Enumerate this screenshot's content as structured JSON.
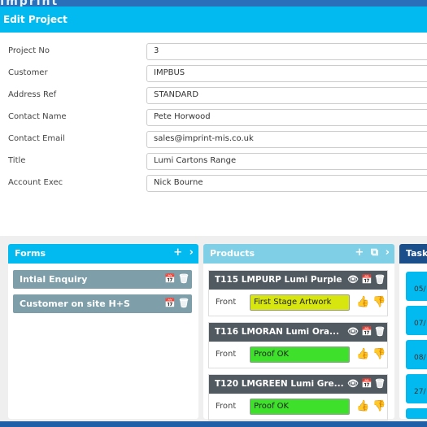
{
  "window": {
    "title": "Edit Project",
    "background_logo": "Imprint"
  },
  "fields": [
    {
      "label": "Project No",
      "value": "3"
    },
    {
      "label": "Customer",
      "value": "IMPBUS"
    },
    {
      "label": "Address Ref",
      "value": "STANDARD"
    },
    {
      "label": "Contact Name",
      "value": "Pete Horwood"
    },
    {
      "label": "Contact Email",
      "value": "sales@imprint-mis.co.uk"
    },
    {
      "label": "Title",
      "value": "Lumi Cartons Range"
    },
    {
      "label": "Account Exec",
      "value": "Nick Bourne"
    }
  ],
  "forms_panel": {
    "title": "Forms",
    "add_icon": "+",
    "chevron_icon": "›",
    "items": [
      {
        "label": "Intial Enquiry"
      },
      {
        "label": "Customer on site H+S"
      }
    ]
  },
  "products_panel": {
    "title": "Products",
    "add_icon": "+",
    "copy_icon": "⧉",
    "chevron_icon": "›",
    "items": [
      {
        "title": "T115 LMPURP Lumi Purple",
        "side": "Front",
        "status": "First Stage Artwork",
        "status_color": "#d6e60e",
        "down_color": "#555555"
      },
      {
        "title": "T116 LMORAN Lumi Ora...",
        "side": "Front",
        "status": "Proof OK",
        "status_color": "#3ee02c",
        "down_color": "#e82626"
      },
      {
        "title": "T120 LMGREEN Lumi Gre...",
        "side": "Front",
        "status": "Proof OK",
        "status_color": "#3ee02c",
        "down_color": "#e82626"
      }
    ]
  },
  "tasks_panel": {
    "title": "Tasks",
    "items": [
      {
        "date": "05/"
      },
      {
        "date": "07/"
      },
      {
        "date": "08/"
      },
      {
        "date": "27/"
      },
      {
        "date": ""
      }
    ]
  },
  "icons": {
    "view": "👁",
    "calendar": "📅",
    "trash": "🗑",
    "thumbs_up": "👍",
    "thumbs_down": "👎"
  },
  "colors": {
    "header": "#03baf0",
    "products_header": "#7fcfe6",
    "tasks_header": "#1a4f8c",
    "form_item": "#7e9fa9",
    "product_header": "#505a60"
  }
}
